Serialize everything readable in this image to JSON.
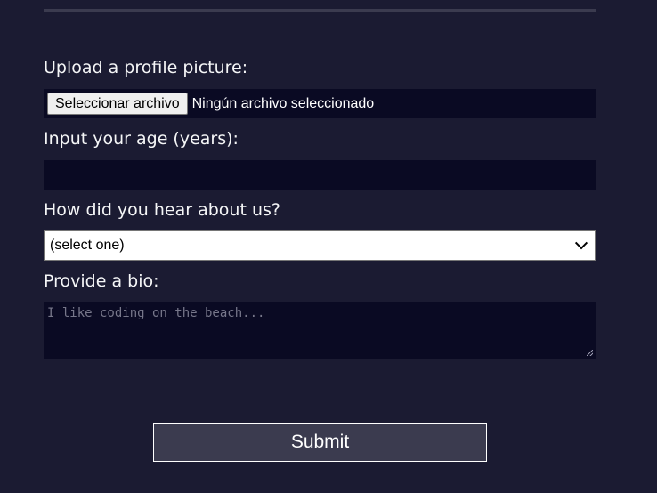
{
  "form": {
    "upload_label": "Upload a profile picture:",
    "file_button_label": "Seleccionar archivo",
    "file_status": "Ningún archivo seleccionado",
    "age_label": "Input your age (years):",
    "age_value": "",
    "referrer_label": "How did you hear about us?",
    "referrer_selected": "(select one)",
    "bio_label": "Provide a bio:",
    "bio_placeholder": "I like coding on the beach...",
    "submit_label": "Submit"
  },
  "colors": {
    "background": "#1b1b32",
    "input_background": "#0a0a23",
    "button_background": "#3b3b4f",
    "text": "#f5f6f7"
  }
}
